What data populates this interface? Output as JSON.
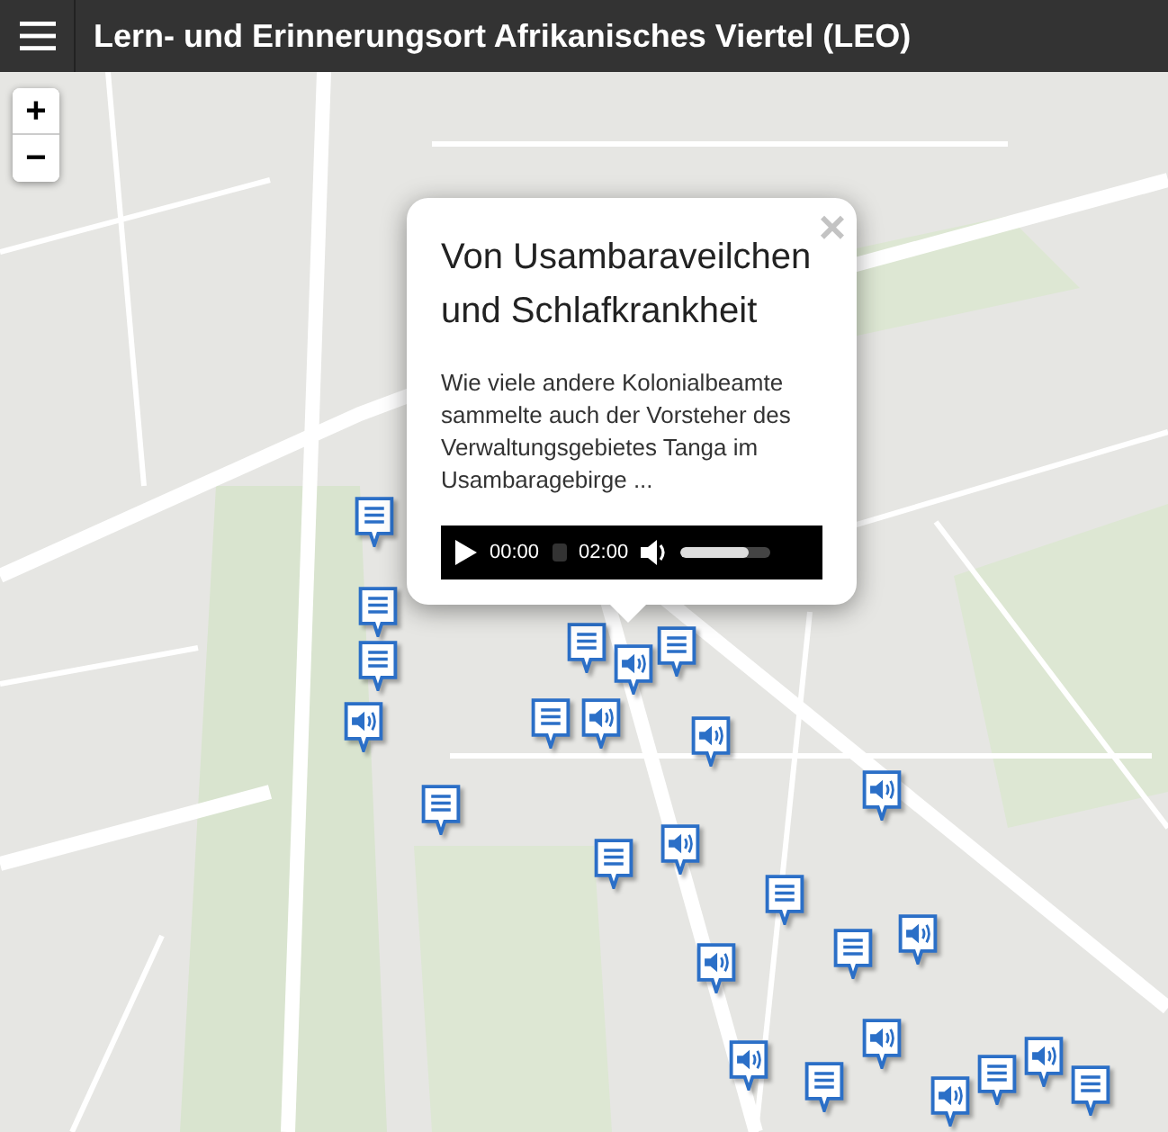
{
  "header": {
    "title": "Lern- und Erinnerungsort Afrikanisches Viertel (LEO)"
  },
  "zoom_controls": [
    "+",
    "−"
  ],
  "markers": [
    {
      "kind": "text"
    },
    {
      "kind": "text"
    },
    {
      "kind": "text"
    },
    {
      "kind": "audio"
    },
    {
      "kind": "text"
    },
    {
      "kind": "text"
    },
    {
      "kind": "text"
    },
    {
      "kind": "audio"
    },
    {
      "kind": "text"
    },
    {
      "kind": "audio"
    },
    {
      "kind": "audio"
    },
    {
      "kind": "audio"
    },
    {
      "kind": "audio"
    },
    {
      "kind": "text"
    },
    {
      "kind": "text"
    },
    {
      "kind": "audio"
    },
    {
      "kind": "audio"
    },
    {
      "kind": "text"
    },
    {
      "kind": "audio"
    },
    {
      "kind": "audio"
    },
    {
      "kind": "text"
    },
    {
      "kind": "audio"
    },
    {
      "kind": "text"
    },
    {
      "kind": "audio"
    },
    {
      "kind": "text"
    }
  ],
  "popup": {
    "title": "Von Usambaraveilchen und Schlafkrankheit",
    "close": "×",
    "text": "Wie viele andere Kolonialbeamte sammelte auch der Vorsteher des Verwaltungsgebietes Tanga im Usambaragebirge ...",
    "player": {
      "current_time": "00:00",
      "duration": "02:00",
      "volume": {
        "level": 0.75
      }
    }
  }
}
